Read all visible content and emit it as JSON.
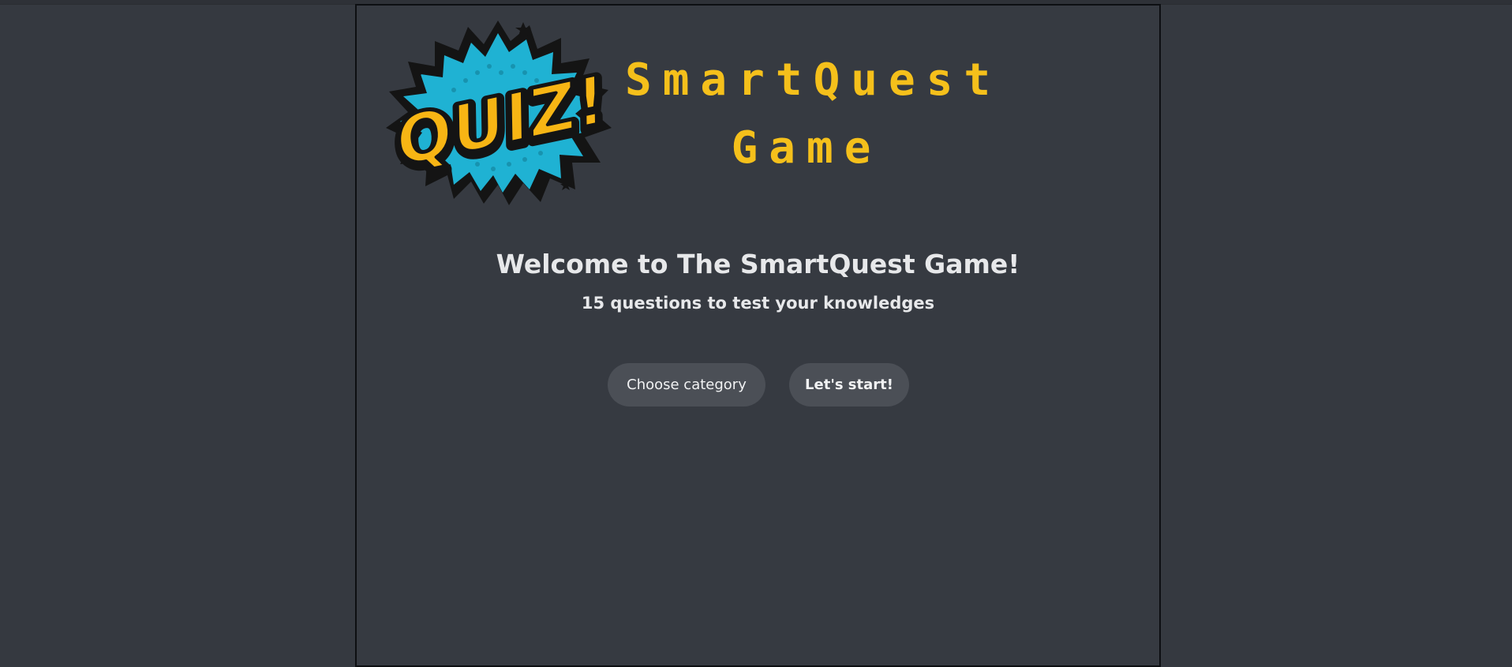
{
  "header": {
    "logo_text": "QUIZ!",
    "title_line1": "SmartQuest",
    "title_line2": "Game"
  },
  "welcome": {
    "title": "Welcome to The SmartQuest Game!",
    "subtitle": "15 questions to test your knowledges"
  },
  "buttons": {
    "choose_category": "Choose category",
    "start": "Let's start!"
  },
  "colors": {
    "background": "#353940",
    "title_yellow": "#f5c01b",
    "button_bg": "#4b4f56",
    "text": "#e7e8ea",
    "burst_cyan": "#1fb2d3"
  }
}
